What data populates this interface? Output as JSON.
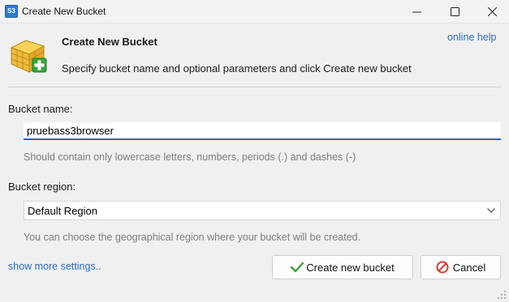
{
  "window": {
    "title": "Create New Bucket",
    "app_icon_text": "S3"
  },
  "header": {
    "title": "Create New Bucket",
    "description": "Specify bucket name and optional parameters and click Create new bucket",
    "online_help": "online help"
  },
  "form": {
    "bucket_name_label": "Bucket name:",
    "bucket_name_value": "pruebass3browser",
    "bucket_name_hint": "Should contain only lowercase letters, numbers, periods (.) and dashes (-)",
    "bucket_region_label": "Bucket region:",
    "bucket_region_value": "Default Region",
    "bucket_region_hint": "You can choose the geographical region where your bucket will be created."
  },
  "footer": {
    "show_more": "show more settings..",
    "create_label": "Create new bucket",
    "cancel_label": "Cancel"
  },
  "icons": {
    "app": "s3-app-icon",
    "logo": "bucket-add-icon",
    "create": "checkmark-icon",
    "cancel": "cancel-circle-icon",
    "dropdown": "chevron-down-icon"
  },
  "colors": {
    "link": "#2a6bc9",
    "input_focus": "#2565c4",
    "hint": "#7d7d7d",
    "check_green": "#3aa53a",
    "cancel_red": "#d93a2b"
  }
}
